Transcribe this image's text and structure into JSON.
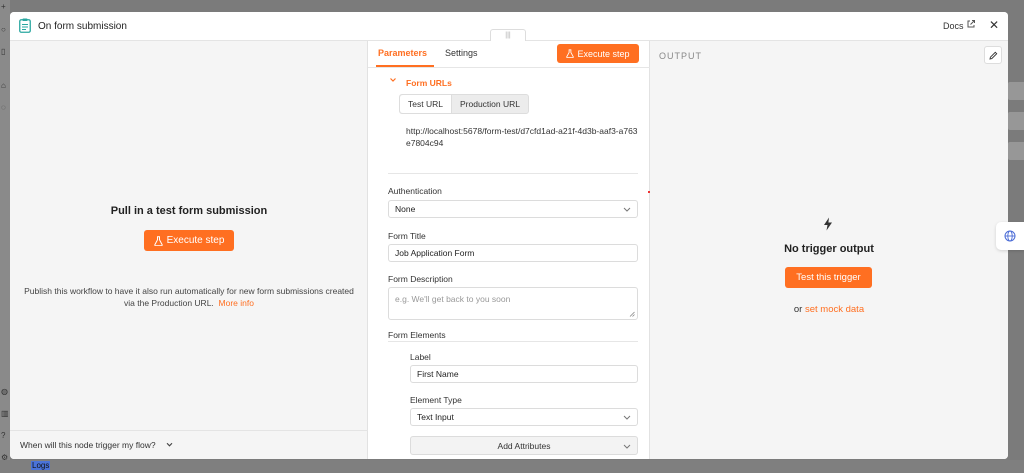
{
  "app": {
    "bottom_bar_label": "Logs"
  },
  "modal": {
    "title": "On form submission",
    "docs_label": "Docs"
  },
  "left_panel": {
    "heading": "Pull in a test form submission",
    "execute_label": "Execute step",
    "publish_text": "Publish this workflow to have it also run automatically for new form submissions created via the Production URL.",
    "more_info_label": "More info",
    "footer_question": "When will this node trigger my flow?"
  },
  "params_panel": {
    "tabs": [
      {
        "label": "Parameters",
        "active": true
      },
      {
        "label": "Settings",
        "active": false
      }
    ],
    "execute_label": "Execute step",
    "form_urls": {
      "title": "Form URLs",
      "toggle": [
        "Test URL",
        "Production URL"
      ],
      "selected": "Test URL",
      "url": "http://localhost:5678/form-test/d7cfd1ad-a21f-4d3b-aaf3-a763e7804c94"
    },
    "authentication": {
      "label": "Authentication",
      "value": "None"
    },
    "form_title": {
      "label": "Form Title",
      "value": "Job Application Form"
    },
    "form_description": {
      "label": "Form Description",
      "placeholder": "e.g. We'll get back to you soon"
    },
    "form_elements": {
      "title": "Form Elements",
      "label_field": {
        "label": "Label",
        "value": "First Name"
      },
      "element_type": {
        "label": "Element Type",
        "value": "Text Input"
      },
      "add_attributes_label": "Add Attributes"
    }
  },
  "output_panel": {
    "title": "OUTPUT",
    "empty_title": "No trigger output",
    "test_button": "Test this trigger",
    "or_text": "or",
    "mock_link": "set mock data"
  },
  "colors": {
    "accent": "#ff6f21",
    "panel_bg": "#f5f5f5",
    "overlay": "#7b7b7b"
  },
  "icons": [
    "form-icon",
    "external-link-icon",
    "close-icon",
    "flask-icon",
    "chevron-down-icon",
    "pencil-icon",
    "bolt-icon",
    "globe-icon"
  ]
}
